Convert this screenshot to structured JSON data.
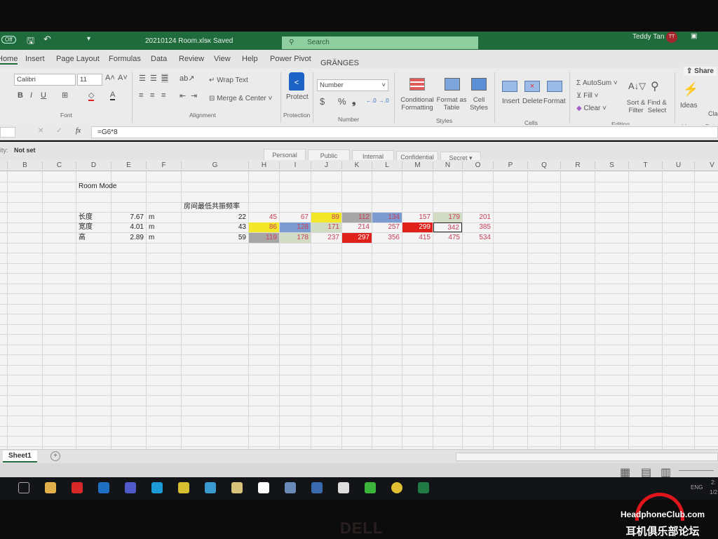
{
  "titlebar": {
    "autosave": "Off",
    "filename": "20210124 Room.xlsx",
    "status": "Saved",
    "separator": "-",
    "search_placeholder": "Search",
    "user": "Teddy Tan",
    "user_initials": "TT",
    "accent": "#1f6b3c"
  },
  "tabs": [
    "Home",
    "Insert",
    "Page Layout",
    "Formulas",
    "Data",
    "Review",
    "View",
    "Help",
    "Power Pivot",
    "GRÄNGES"
  ],
  "share_label": "Share",
  "ribbon": {
    "font_name": "Calibri",
    "font_size": "11",
    "bold": "B",
    "italic": "I",
    "underline": "U",
    "font_group": "Font",
    "alignment_group": "Alignment",
    "wrap_text": "Wrap Text",
    "merge_center": "Merge & Center",
    "protect": "Protect",
    "protection_group": "Protection",
    "number_format": "Number",
    "number_group": "Number",
    "currency": "$",
    "percent": "%",
    "comma": "❟",
    "conditional_formatting": "Conditional Formatting",
    "format_as_table": "Format as Table",
    "cell_styles": "Cell Styles",
    "styles_group": "Styles",
    "insert": "Insert",
    "delete": "Delete",
    "format": "Format",
    "cells_group": "Cells",
    "autosum": "AutoSum",
    "fill": "Fill",
    "clear": "Clear",
    "sort_filter": "Sort & Filter",
    "find_select": "Find & Select",
    "editing_group": "Editing",
    "ideas": "Ideas",
    "ideas_group": "Ideas",
    "data_group_partial": "Data",
    "classify_partial": "Clas"
  },
  "formula_bar": {
    "fx": "fx",
    "formula": "=G6*8"
  },
  "sensitivity": {
    "label": "ity:",
    "value": "Not set",
    "options": [
      "Personal",
      "Public",
      "Internal",
      "Confidential",
      "Secret"
    ]
  },
  "columns": [
    "B",
    "C",
    "D",
    "E",
    "F",
    "G",
    "H",
    "I",
    "J",
    "K",
    "L",
    "M",
    "N",
    "O",
    "P",
    "Q",
    "R",
    "S",
    "T",
    "U",
    "V"
  ],
  "cells": [
    {
      "col": "D",
      "row": 2,
      "value": "Room Mode",
      "kind": "text"
    },
    {
      "col": "G",
      "row": 4,
      "value": "房间最低共振频率",
      "kind": "text"
    },
    {
      "col": "D",
      "row": 5,
      "value": "长度",
      "kind": "text"
    },
    {
      "col": "E",
      "row": 5,
      "value": "7.67",
      "kind": "num"
    },
    {
      "col": "F",
      "row": 5,
      "value": "m",
      "kind": "text"
    },
    {
      "col": "D",
      "row": 6,
      "value": "宽度",
      "kind": "text"
    },
    {
      "col": "E",
      "row": 6,
      "value": "4.01",
      "kind": "num"
    },
    {
      "col": "F",
      "row": 6,
      "value": "m",
      "kind": "text"
    },
    {
      "col": "D",
      "row": 7,
      "value": "高",
      "kind": "text"
    },
    {
      "col": "E",
      "row": 7,
      "value": "2.89",
      "kind": "num"
    },
    {
      "col": "F",
      "row": 7,
      "value": "m",
      "kind": "text"
    },
    {
      "col": "G",
      "row": 5,
      "value": "22",
      "kind": "num"
    },
    {
      "col": "G",
      "row": 6,
      "value": "43",
      "kind": "num"
    },
    {
      "col": "G",
      "row": 7,
      "value": "59",
      "kind": "num"
    },
    {
      "col": "H",
      "row": 5,
      "value": "45",
      "kind": "mode"
    },
    {
      "col": "I",
      "row": 5,
      "value": "67",
      "kind": "mode"
    },
    {
      "col": "J",
      "row": 5,
      "value": "89",
      "kind": "mode",
      "fill": "#f2e829"
    },
    {
      "col": "K",
      "row": 5,
      "value": "112",
      "kind": "mode",
      "fill": "#a6a6a6"
    },
    {
      "col": "L",
      "row": 5,
      "value": "134",
      "kind": "mode",
      "fill": "#7b9bd1"
    },
    {
      "col": "M",
      "row": 5,
      "value": "157",
      "kind": "mode"
    },
    {
      "col": "N",
      "row": 5,
      "value": "179",
      "kind": "mode",
      "fill": "#d2dcc4"
    },
    {
      "col": "O",
      "row": 5,
      "value": "201",
      "kind": "mode"
    },
    {
      "col": "H",
      "row": 6,
      "value": "86",
      "kind": "mode",
      "fill": "#f2e829"
    },
    {
      "col": "I",
      "row": 6,
      "value": "128",
      "kind": "mode",
      "fill": "#7b9bd1"
    },
    {
      "col": "J",
      "row": 6,
      "value": "171",
      "kind": "mode",
      "fill": "#d2dcc4"
    },
    {
      "col": "K",
      "row": 6,
      "value": "214",
      "kind": "mode"
    },
    {
      "col": "L",
      "row": 6,
      "value": "257",
      "kind": "mode"
    },
    {
      "col": "M",
      "row": 6,
      "value": "299",
      "kind": "mode",
      "fill": "#e0201a",
      "color": "#ffffff"
    },
    {
      "col": "N",
      "row": 6,
      "value": "342",
      "kind": "mode",
      "selected": true
    },
    {
      "col": "O",
      "row": 6,
      "value": "385",
      "kind": "mode"
    },
    {
      "col": "H",
      "row": 7,
      "value": "119",
      "kind": "mode",
      "fill": "#a6a6a6"
    },
    {
      "col": "I",
      "row": 7,
      "value": "178",
      "kind": "mode",
      "fill": "#d2dcc4"
    },
    {
      "col": "J",
      "row": 7,
      "value": "237",
      "kind": "mode"
    },
    {
      "col": "K",
      "row": 7,
      "value": "297",
      "kind": "mode",
      "fill": "#e0201a",
      "color": "#ffffff"
    },
    {
      "col": "L",
      "row": 7,
      "value": "356",
      "kind": "mode"
    },
    {
      "col": "M",
      "row": 7,
      "value": "415",
      "kind": "mode"
    },
    {
      "col": "N",
      "row": 7,
      "value": "475",
      "kind": "mode"
    },
    {
      "col": "O",
      "row": 7,
      "value": "534",
      "kind": "mode"
    }
  ],
  "mode_text_color": "#c8405a",
  "sheet_tabs": [
    "Sheet1"
  ],
  "taskbar": {
    "icons": [
      "task-view",
      "file-explorer",
      "youdao",
      "outlook",
      "teams",
      "edge",
      "keepass",
      "vpn",
      "notes",
      "media-player",
      "photo-app",
      "remote-desktop",
      "network-app",
      "green-app",
      "chrome",
      "excel"
    ],
    "tray": {
      "language": "ENG",
      "time_partial": "2:",
      "date_partial": "1/2"
    }
  },
  "laptop_brand": "DELL",
  "watermark": {
    "line1": "HeadphoneClub.com",
    "line2": "耳机俱乐部论坛"
  }
}
